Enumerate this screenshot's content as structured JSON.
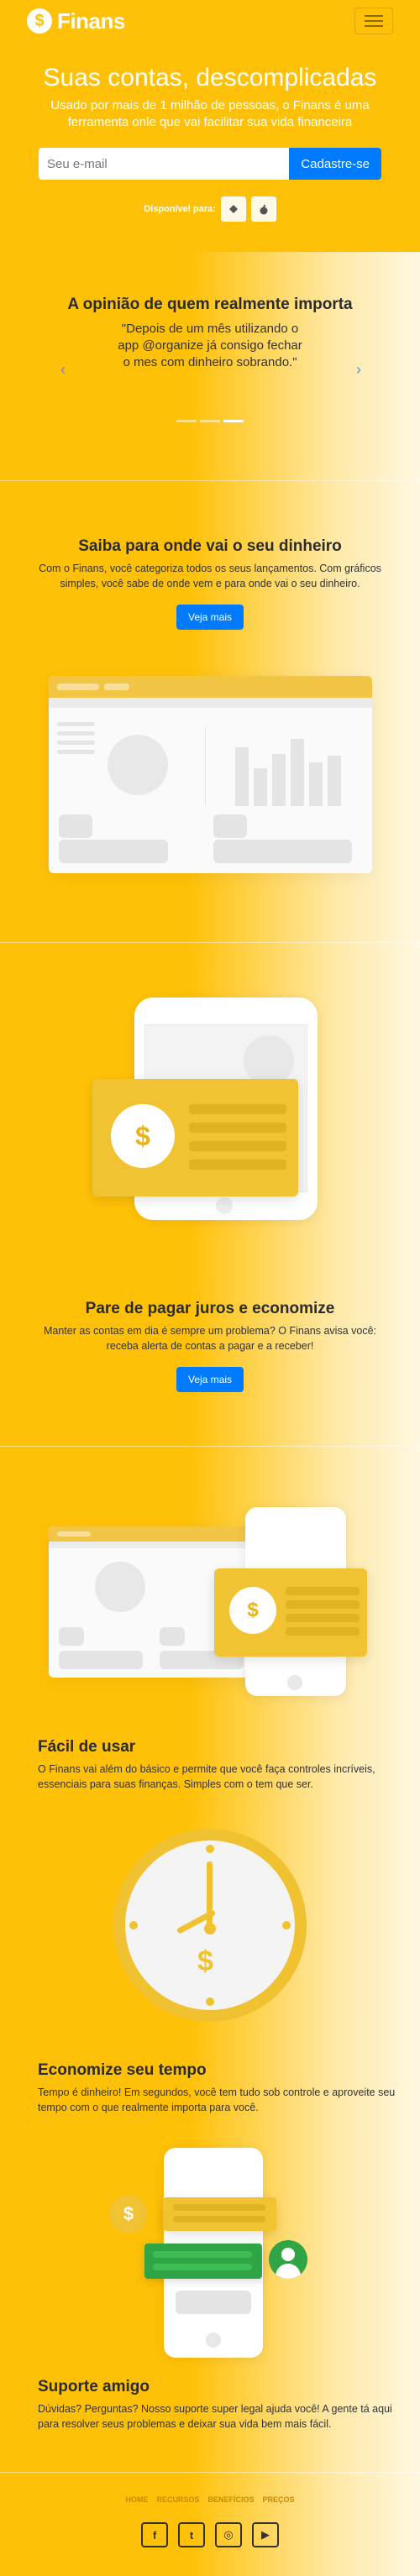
{
  "brand": {
    "name": "Finans",
    "logo_symbol": "$"
  },
  "nav": {
    "menu_icon": "hamburger-icon"
  },
  "hero": {
    "title": "Suas contas, descomplicadas",
    "subtitle": "Usado por mais de 1 milhão de pessoas, o Finans é uma ferramenta onle que vai facilitar sua vida financeira",
    "email_placeholder": "Seu e-mail",
    "signup_label": "Cadastre-se",
    "available_label": "Disponível para:",
    "stores": [
      "android-icon",
      "apple-icon"
    ]
  },
  "testimonials": {
    "title": "A opinião de quem realmente importa",
    "quote": "\"Depois de um mês utilizando o app @organize já consigo fechar o mes com dinheiro sobrando.\"",
    "prev_icon": "chevron-left-icon",
    "next_icon": "chevron-right-icon",
    "active_index": 2,
    "count": 3
  },
  "features": {
    "saiba": {
      "title": "Saiba para onde vai o seu dinheiro",
      "text": "Com o Finans, você categoriza todos os seus lançamentos. Com gráficos simples, você sabe de onde vem e para onde vai o seu dinheiro.",
      "button": "Veja mais"
    },
    "juros": {
      "title": "Pare de pagar juros e economize",
      "text": "Manter as contas em dia é sempre um problema? O Finans avisa você: receba alerta de contas a pagar e a receber!",
      "button": "Veja mais"
    },
    "facil": {
      "title": "Fácil de usar",
      "text": "O Finans vai além do básico e permite que você faça controles incríveis, essenciais para suas finanças. Simples com o tem que ser."
    },
    "tempo": {
      "title": "Economize seu tempo",
      "text": "Tempo é dinheiro! Em segundos, você tem tudo sob controle e aproveite seu tempo com o que realmente importa para você."
    },
    "suporte": {
      "title": "Suporte amigo",
      "text": "Dúvidas? Perguntas? Nosso suporte super legal ajuda você! A gente tá aqui para resolver seus problemas e deixar sua vida bem mais fácil."
    }
  },
  "footer": {
    "links": [
      "HOME",
      "RECURSOS",
      "BENEFÍCIOS",
      "PREÇOS"
    ],
    "socials": [
      {
        "icon": "facebook-icon",
        "glyph": "f"
      },
      {
        "icon": "twitter-icon",
        "glyph": "t"
      },
      {
        "icon": "instagram-icon",
        "glyph": "◎"
      },
      {
        "icon": "youtube-icon",
        "glyph": "▶"
      }
    ]
  },
  "colors": {
    "primary": "#ffc107",
    "button": "#007bff",
    "card": "#f1c232"
  }
}
